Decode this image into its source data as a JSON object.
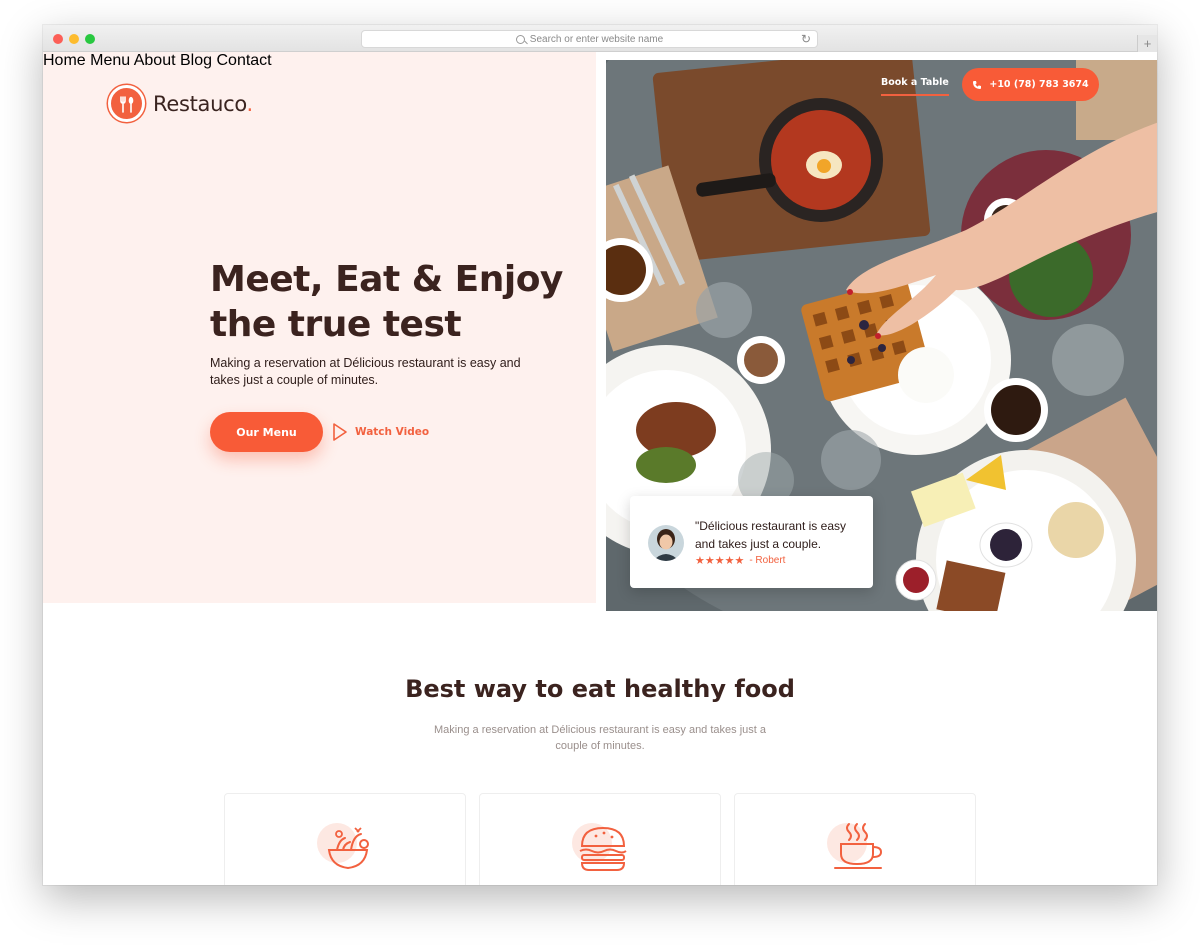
{
  "browser": {
    "url_placeholder": "Search or enter website name",
    "reload_icon": "reload-icon",
    "new_tab_label": "+"
  },
  "brand": {
    "name": "Restauco",
    "name_suffix": ".",
    "accent_color": "#f2613f",
    "dark_color": "#3b231f",
    "hero_bg": "#fef1ee"
  },
  "nav": {
    "items": [
      {
        "label": "Home"
      },
      {
        "label": "Menu"
      },
      {
        "label": "About"
      },
      {
        "label": "Blog"
      },
      {
        "label": "Contact"
      }
    ],
    "book_table": "Book a Table",
    "phone": "+10 (78) 783 3674"
  },
  "hero": {
    "title_line1": "Meet, Eat & Enjoy",
    "title_line2": "the true test",
    "subtitle": "Making a reservation at Délicious restaurant is easy and takes just a couple of minutes.",
    "primary_button": "Our Menu",
    "video_link": "Watch Video"
  },
  "review": {
    "quote_line1": "\"Délicious restaurant is easy",
    "quote_line2": "and takes just a couple.",
    "stars": "★★★★★",
    "rating": 5,
    "author": "- Robert"
  },
  "features": {
    "title": "Best way to eat healthy food",
    "subtitle_line1": "Making a reservation at Délicious restaurant is easy and takes just a",
    "subtitle_line2": "couple of minutes.",
    "cards": [
      {
        "icon": "salad-bowl-icon"
      },
      {
        "icon": "burger-icon"
      },
      {
        "icon": "coffee-cup-icon"
      }
    ]
  }
}
